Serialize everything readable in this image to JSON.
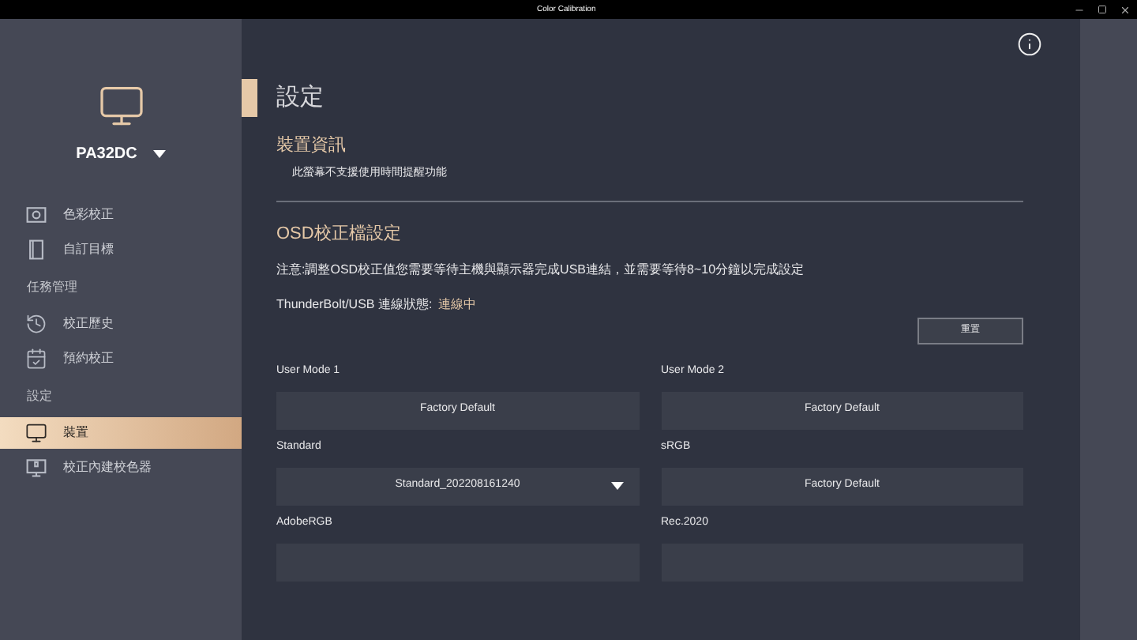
{
  "window": {
    "title": "Color Calibration"
  },
  "sidebar": {
    "device": "PA32DC",
    "items": [
      {
        "kind": "item",
        "label": "色彩校正",
        "selected": false
      },
      {
        "kind": "item",
        "label": "自訂目標",
        "selected": false
      },
      {
        "kind": "heading",
        "label": "任務管理"
      },
      {
        "kind": "item",
        "label": "校正歷史",
        "selected": false
      },
      {
        "kind": "item",
        "label": "預約校正",
        "selected": false
      },
      {
        "kind": "heading",
        "label": "設定"
      },
      {
        "kind": "item",
        "label": "裝置",
        "selected": true
      },
      {
        "kind": "item",
        "label": "校正內建校色器",
        "selected": false
      }
    ]
  },
  "page_title": "設定",
  "device_info": {
    "title": "裝置資訊",
    "note": "此螢幕不支援使用時間提醒功能"
  },
  "osd": {
    "title": "OSD校正檔設定",
    "notice": "注意:調整OSD校正值您需要等待主機與顯示器完成USB連結，並需要等待8~10分鐘以完成設定",
    "status_label": "ThunderBolt/USB 連線狀態:",
    "status_value": "連線中",
    "reset_button": "重置"
  },
  "profiles": [
    {
      "label": "User Mode 1",
      "kind": "button",
      "value": "Factory Default"
    },
    {
      "label": "User Mode 2",
      "kind": "button",
      "value": "Factory Default"
    },
    {
      "label": "Standard",
      "kind": "dropdown",
      "value": "Standard_202208161240"
    },
    {
      "label": "sRGB",
      "kind": "button",
      "value": "Factory Default"
    },
    {
      "label": "AdobeRGB",
      "kind": "button"
    },
    {
      "label": "Rec.2020",
      "kind": "button"
    }
  ]
}
